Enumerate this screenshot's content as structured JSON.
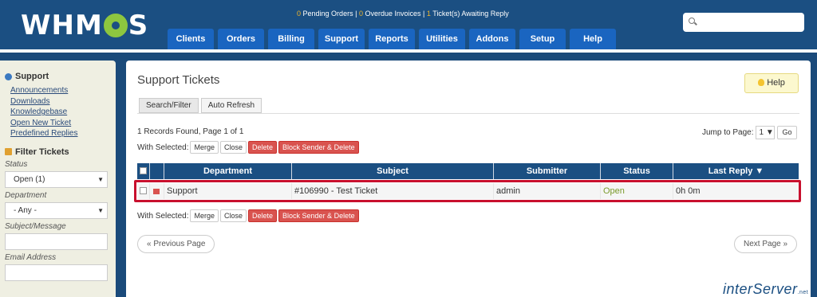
{
  "header": {
    "logo": "WHMCS",
    "notices": {
      "pending_orders_count": "0",
      "pending_orders_label": "Pending Orders",
      "overdue_invoices_count": "0",
      "overdue_invoices_label": "Overdue Invoices",
      "tickets_count": "1",
      "tickets_label": "Ticket(s) Awaiting Reply",
      "separator": "|"
    },
    "search_placeholder": "",
    "nav": [
      "Clients",
      "Orders",
      "Billing",
      "Support",
      "Reports",
      "Utilities",
      "Addons",
      "Setup",
      "Help"
    ]
  },
  "sidebar": {
    "support_heading": "Support",
    "links": [
      "Announcements",
      "Downloads",
      "Knowledgebase",
      "Open New Ticket",
      "Predefined Replies"
    ],
    "filter_heading": "Filter Tickets",
    "status_label": "Status",
    "status_value": "Open (1)",
    "department_label": "Department",
    "department_value": "- Any -",
    "subject_label": "Subject/Message",
    "email_label": "Email Address"
  },
  "main": {
    "title": "Support Tickets",
    "help_button": "Help",
    "tabs": [
      "Search/Filter",
      "Auto Refresh"
    ],
    "records_text": "1 Records Found, Page 1 of 1",
    "with_selected": "With Selected:",
    "actions": [
      "Merge",
      "Close",
      "Delete",
      "Block Sender & Delete"
    ],
    "jump_label": "Jump to Page:",
    "jump_value": "1",
    "go_label": "Go",
    "columns": [
      "Department",
      "Subject",
      "Submitter",
      "Status",
      "Last Reply ▼"
    ],
    "row": {
      "department": "Support",
      "subject": "#106990 - Test Ticket",
      "submitter": "admin",
      "status": "Open",
      "last_reply": "0h 0m"
    },
    "prev_page": "« Previous Page",
    "next_page": "Next Page »",
    "brand": "interServer",
    "brand_suffix": ".net"
  }
}
